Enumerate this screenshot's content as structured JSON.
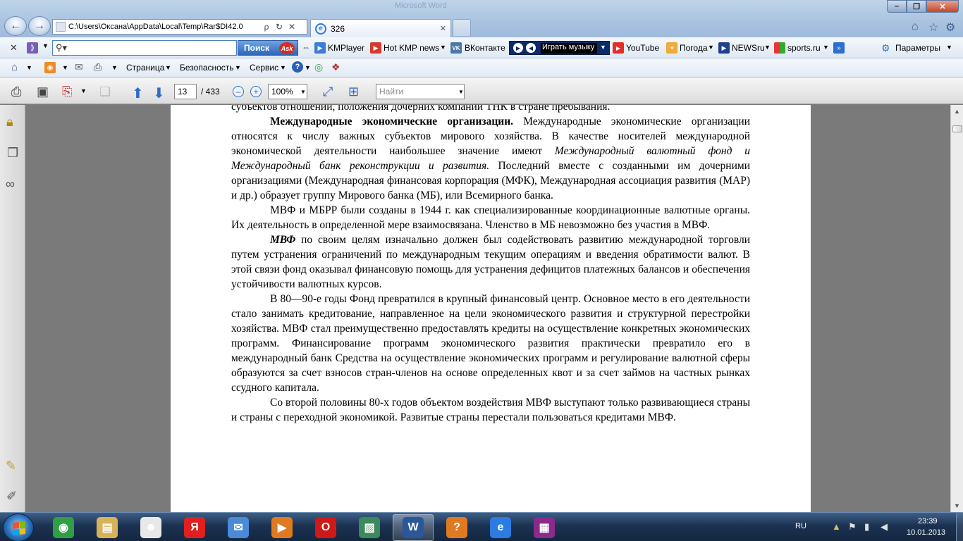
{
  "window": {
    "background_title": "Microsoft Word"
  },
  "address_bar": {
    "url": "C:\\Users\\Оксана\\AppData\\Local\\Temp\\Rar$DI42.0",
    "search_glyph": "ρ",
    "refresh_glyph": "↻",
    "stop_glyph": "✕"
  },
  "tab": {
    "title": "326"
  },
  "search_toolbar": {
    "placeholder": "",
    "button_label": "Поиск",
    "ask_logo": "Ask"
  },
  "favorites": [
    {
      "label": "KMPlayer",
      "color": "#3a7dd8"
    },
    {
      "label": "Hot KMP news",
      "color": "#d63a2f"
    },
    {
      "label": "ВКонтакте",
      "color": "#4a76a8"
    },
    {
      "label": "YouTube",
      "color": "#e52d27"
    },
    {
      "label": "Погода",
      "color": "#f0a93a"
    },
    {
      "label": "NEWSru",
      "color": "#1f3f8f"
    },
    {
      "label": "sports.ru",
      "color": "#c23"
    }
  ],
  "music_widget": {
    "label": "Играть музыку"
  },
  "parameters": {
    "label": "Параметры"
  },
  "command_bar": {
    "page_menu": "Страница",
    "safety_menu": "Безопасность",
    "service_menu": "Сервис"
  },
  "pdf_toolbar": {
    "current_page": "13",
    "total_pages": "/ 433",
    "zoom": "100%",
    "find_placeholder": "Найти"
  },
  "document": {
    "line_top": "субъектов отношений, положения дочерних компаний ТНК в стране пребывания.",
    "p1_heading": "Международные экономические организации.",
    "p1_text_a": " Международные экономические организации относятся к числу важных субъектов мирового хозяйства. В качестве носителей международной экономической деятельности наибольшее значение имеют ",
    "p1_italic": "Международный валютный фонд и Международный банк реконструкции и развития.",
    "p1_text_b": " Последний вместе с созданными им дочерними организациями (Международная финансовая корпорация (МФК), Международная ассоциация развития (МАР) и др.) образует группу Мирового банка (МБ), или Всемирного банка.",
    "p2": "МВФ и МБРР были созданы в 1944 г. как специализированные координационные валютные органы. Их деятельность в определенной мере взаимосвязана. Членство в МБ невозможно без участия в МВФ.",
    "p3_heading": "МВФ",
    "p3_text": " по своим целям изначально должен был содействовать развитию международной торговли путем устранения ограничений по международным текущим операциям и введения обратимости валют. В этой связи фонд оказывал финансовую помощь для устранения дефицитов платежных балансов и обеспечения устойчивости валютных курсов.",
    "p4": "В 80—90-е годы Фонд превратился в крупный финансовый центр. Основное место в его деятельности стало занимать кредитование, направленное на цели экономического развития и структурной перестройки хозяйства. МВФ стал преимущественно предоставлять кредиты на осуществление конкретных экономических программ. Финансирование программ экономического развития практически превратило его в международный банк Средства на осуществление экономических программ и регулирование валютной сферы образуются за счет взносов стран-членов на основе определенных квот и за счет займов на частных рынках ссудного капитала.",
    "p5": "Со второй половины 80-х годов объектом воздействия МВФ выступают только развивающиеся страны и страны с переходной экономикой. Развитые страны перестали пользоваться кредитами МВФ."
  },
  "taskbar": {
    "apps": [
      {
        "name": "chrome",
        "glyph": "◉",
        "color": "#2f9e44"
      },
      {
        "name": "explorer",
        "glyph": "▤",
        "color": "#d8b25a"
      },
      {
        "name": "agent",
        "glyph": "☻",
        "color": "#e8e8e8"
      },
      {
        "name": "yandex",
        "glyph": "Я",
        "color": "#e02020"
      },
      {
        "name": "mail",
        "glyph": "✉",
        "color": "#4a8ad8"
      },
      {
        "name": "media-player",
        "glyph": "▶",
        "color": "#e07a20"
      },
      {
        "name": "opera",
        "glyph": "O",
        "color": "#d01818"
      },
      {
        "name": "photo-viewer",
        "glyph": "▨",
        "color": "#3a8a5a"
      },
      {
        "name": "word",
        "glyph": "W",
        "color": "#2b579a"
      },
      {
        "name": "help",
        "glyph": "?",
        "color": "#e07a20"
      },
      {
        "name": "internet-explorer",
        "glyph": "e",
        "color": "#2b7be0"
      },
      {
        "name": "winrar",
        "glyph": "▦",
        "color": "#8a2a8a"
      }
    ],
    "language": "RU",
    "time": "23:39",
    "date": "10.01.2013"
  }
}
